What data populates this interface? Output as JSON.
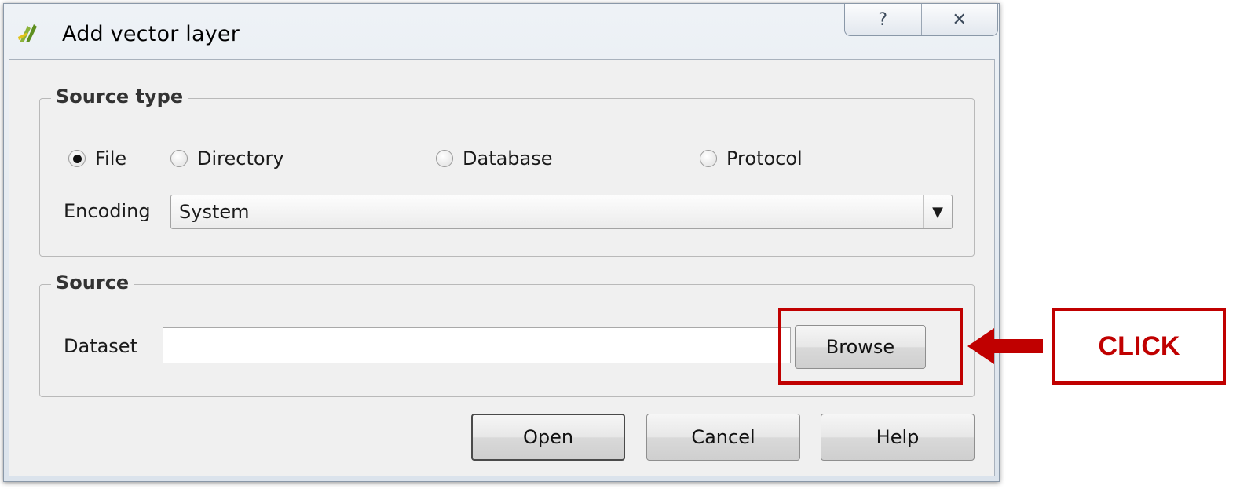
{
  "window": {
    "title": "Add vector layer",
    "help_glyph": "?",
    "close_glyph": "✕"
  },
  "source_type": {
    "legend": "Source type",
    "options": [
      {
        "label": "File",
        "selected": true
      },
      {
        "label": "Directory",
        "selected": false
      },
      {
        "label": "Database",
        "selected": false
      },
      {
        "label": "Protocol",
        "selected": false
      }
    ],
    "encoding_label": "Encoding",
    "encoding_value": "System"
  },
  "source": {
    "legend": "Source",
    "dataset_label": "Dataset",
    "dataset_value": "",
    "browse_label": "Browse"
  },
  "buttons": {
    "open": "Open",
    "cancel": "Cancel",
    "help": "Help"
  },
  "annotation": {
    "callout_text": "CLICK",
    "color": "#c00000"
  }
}
